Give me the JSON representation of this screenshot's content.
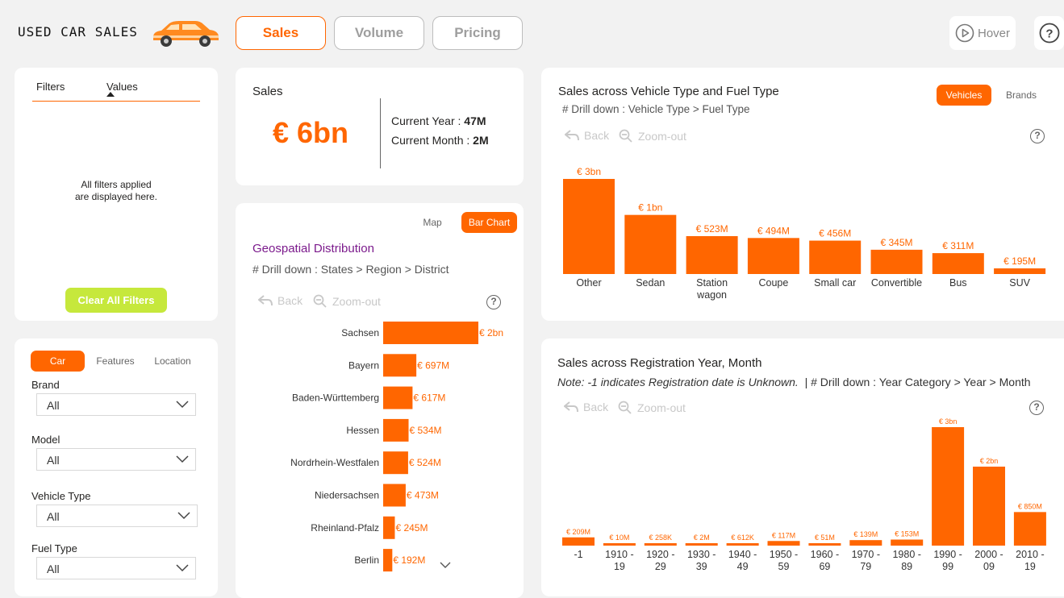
{
  "header": {
    "title": "USED CAR SALES",
    "tabs": [
      "Sales",
      "Volume",
      "Pricing"
    ],
    "active_tab": "Sales",
    "hover_label": "Hover",
    "help_symbol": "?"
  },
  "colors": {
    "accent": "#ff6600",
    "lime": "#c6e83c",
    "title_purple": "#7b1a8c"
  },
  "filters_panel": {
    "col1": "Filters",
    "col2": "Values",
    "empty_line1": "All filters applied",
    "empty_line2": "are displayed here.",
    "clear_label": "Clear All Filters"
  },
  "slicer_panel": {
    "tabs": [
      "Car",
      "Features",
      "Location"
    ],
    "active_tab": "Car",
    "fields": [
      {
        "label": "Brand",
        "value": "All"
      },
      {
        "label": "Model",
        "value": "All"
      },
      {
        "label": "Vehicle Type",
        "value": "All"
      },
      {
        "label": "Fuel Type",
        "value": "All"
      }
    ]
  },
  "kpi": {
    "title": "Sales",
    "value": "€ 6bn",
    "current_year_label": "Current Year : ",
    "current_year_value": "47M",
    "current_month_label": "Current Month : ",
    "current_month_value": "2M"
  },
  "geo": {
    "toggle": [
      "Map",
      "Bar Chart"
    ],
    "active_toggle": "Bar Chart",
    "title": "Geospatial Distribution",
    "drill": "# Drill down : States > Region > District",
    "back": "Back",
    "zoom_out": "Zoom-out"
  },
  "vehicle": {
    "title": "Sales across Vehicle Type and Fuel Type",
    "drill": "# Drill down : Vehicle Type > Fuel Type",
    "toggle": [
      "Vehicles",
      "Brands"
    ],
    "active_toggle": "Vehicles",
    "back": "Back",
    "zoom_out": "Zoom-out"
  },
  "registration": {
    "title": "Sales across Registration Year, Month",
    "note": "Note: -1 indicates Registration date is Unknown.",
    "drill": "| # Drill down : Year Category > Year > Month",
    "back": "Back",
    "zoom_out": "Zoom-out"
  },
  "chart_data": [
    {
      "id": "geo",
      "type": "bar",
      "orientation": "horizontal",
      "categories": [
        "Sachsen",
        "Bayern",
        "Baden-Württemberg",
        "Hessen",
        "Nordrhein-Westfalen",
        "Niedersachsen",
        "Rheinland-Pfalz",
        "Berlin"
      ],
      "values": [
        2000,
        697,
        617,
        534,
        524,
        473,
        245,
        192
      ],
      "unit": "€M",
      "labels": [
        "€ 2bn",
        "€ 697M",
        "€ 617M",
        "€ 534M",
        "€ 524M",
        "€ 473M",
        "€ 245M",
        "€ 192M"
      ],
      "color": "#ff6600"
    },
    {
      "id": "vehicle",
      "type": "bar",
      "categories": [
        "Other",
        "Sedan",
        "Station wagon",
        "Coupe",
        "Small car",
        "Convertible",
        "Bus",
        "SUV"
      ],
      "values": [
        3000,
        1000,
        523,
        494,
        456,
        345,
        311,
        195
      ],
      "unit": "€M",
      "labels": [
        "€ 3bn",
        "€ 1bn",
        "€ 523M",
        "€ 494M",
        "€ 456M",
        "€ 345M",
        "€ 311M",
        "€ 195M"
      ],
      "color": "#ff6600"
    },
    {
      "id": "registration",
      "type": "bar",
      "categories": [
        "-1",
        "1910 - 19",
        "1920 - 29",
        "1930 - 39",
        "1940 - 49",
        "1950 - 59",
        "1960 - 69",
        "1970 - 79",
        "1980 - 89",
        "1990 - 99",
        "2000 - 09",
        "2010 - 19"
      ],
      "values": [
        209,
        10,
        0.258,
        2,
        0.612,
        117,
        51,
        139,
        153,
        3000,
        2000,
        850
      ],
      "unit": "€M",
      "labels": [
        "€ 209M",
        "€ 10M",
        "€ 258K",
        "€ 2M",
        "€ 612K",
        "€ 117M",
        "€ 51M",
        "€ 139M",
        "€ 153M",
        "€ 3bn",
        "€ 2bn",
        "€ 850M"
      ],
      "color": "#ff6600"
    }
  ]
}
